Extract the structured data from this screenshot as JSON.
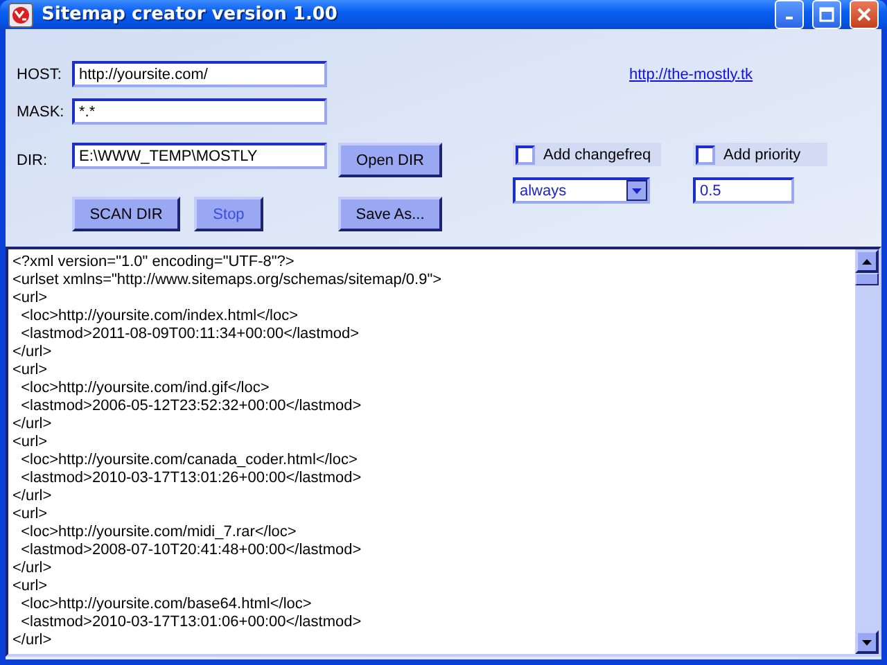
{
  "window": {
    "title": "Sitemap creator version 1.00"
  },
  "fields": [
    {
      "label": "HOST:",
      "value": "http://yoursite.com/"
    },
    {
      "label": "MASK:",
      "value": "*.*"
    },
    {
      "label": "DIR:",
      "value": "E:\\WWW_TEMP\\MOSTLY"
    }
  ],
  "link": "http://the-mostly.tk",
  "buttons": [
    {
      "kind": "open",
      "label": "Open DIR",
      "disabled": false
    },
    {
      "kind": "scan",
      "label": "SCAN DIR",
      "disabled": false
    },
    {
      "kind": "stop",
      "label": "Stop",
      "disabled": true
    },
    {
      "kind": "save",
      "label": "Save As...",
      "disabled": false
    }
  ],
  "options": [
    {
      "label": "Add changefreq",
      "checked": false
    },
    {
      "label": "Add priority",
      "checked": false
    }
  ],
  "changefreq": {
    "value": "always"
  },
  "priority": {
    "value": "0.5"
  },
  "output": {
    "lines": [
      "<?xml version=\"1.0\" encoding=\"UTF-8\"?>",
      "<urlset xmlns=\"http://www.sitemaps.org/schemas/sitemap/0.9\">",
      "<url>",
      "  <loc>http://yoursite.com/index.html</loc>",
      "  <lastmod>2011-08-09T00:11:34+00:00</lastmod>",
      "</url>",
      "<url>",
      "  <loc>http://yoursite.com/ind.gif</loc>",
      "  <lastmod>2006-05-12T23:52:32+00:00</lastmod>",
      "</url>",
      "<url>",
      "  <loc>http://yoursite.com/canada_coder.html</loc>",
      "  <lastmod>2010-03-17T13:01:26+00:00</lastmod>",
      "</url>",
      "<url>",
      "  <loc>http://yoursite.com/midi_7.rar</loc>",
      "  <lastmod>2008-07-10T20:41:48+00:00</lastmod>",
      "</url>",
      "<url>",
      "  <loc>http://yoursite.com/base64.html</loc>",
      "  <lastmod>2010-03-17T13:01:06+00:00</lastmod>",
      "</url>"
    ]
  }
}
